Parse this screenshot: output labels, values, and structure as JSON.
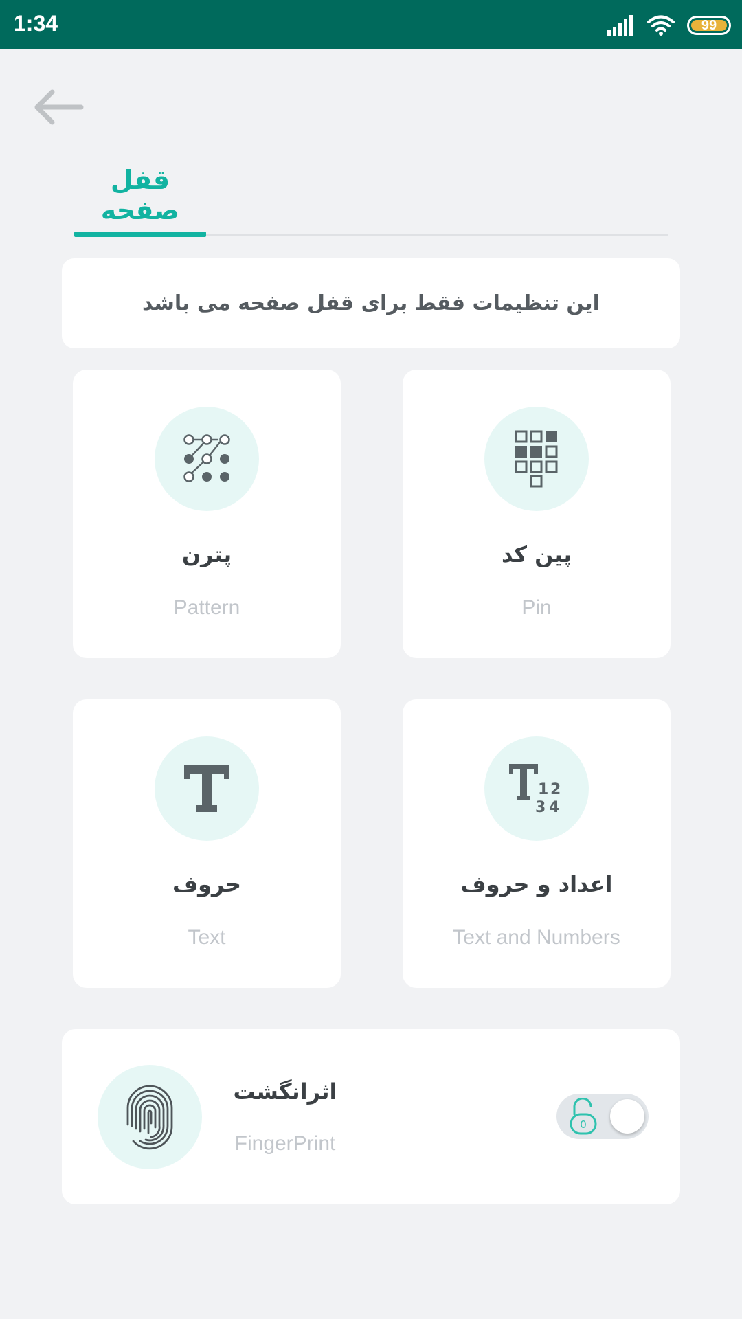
{
  "status_bar": {
    "time": "1:34",
    "battery": "99",
    "icons": [
      "signal-icon",
      "wifi-icon",
      "battery-icon"
    ]
  },
  "nav": {
    "back_icon": "arrow-left-icon"
  },
  "tab": {
    "title": "قفل صفحه"
  },
  "info": {
    "text": "این تنظیمات فقط برای قفل صفحه می باشد"
  },
  "options": [
    {
      "title_fa": "پترن",
      "title_en": "Pattern",
      "icon": "pattern-icon"
    },
    {
      "title_fa": "پین کد",
      "title_en": "Pin",
      "icon": "pin-keypad-icon"
    },
    {
      "title_fa": "حروف",
      "title_en": "Text",
      "icon": "text-icon"
    },
    {
      "title_fa": "اعداد و حروف",
      "title_en": "Text and Numbers",
      "icon": "text-numbers-icon"
    }
  ],
  "fingerprint": {
    "title_fa": "اثرانگشت",
    "title_en": "FingerPrint",
    "icon": "fingerprint-icon",
    "toggle_on": false,
    "lock_digit": "0"
  },
  "colors": {
    "status_bar": "#006a5c",
    "accent": "#12b3a1",
    "icon_circle": "#e6f7f5",
    "background": "#f1f2f4",
    "battery": "#e8b23a"
  }
}
